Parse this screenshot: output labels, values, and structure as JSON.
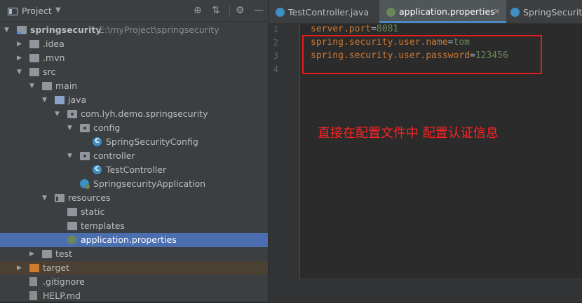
{
  "project_pane": {
    "title": "Project",
    "tools": [
      "⊕",
      "⇅",
      "⚙",
      "—"
    ]
  },
  "tree": [
    {
      "label": "springsecurity",
      "hint": "E:\\myProject\\springsecurity",
      "icon": "module-folder-icon",
      "depth": 0,
      "arrow": "down",
      "bold": true
    },
    {
      "label": ".idea",
      "icon": "folder-icon",
      "depth": 1,
      "arrow": "right"
    },
    {
      "label": ".mvn",
      "icon": "folder-icon",
      "depth": 1,
      "arrow": "right"
    },
    {
      "label": "src",
      "icon": "folder-icon",
      "depth": 1,
      "arrow": "down"
    },
    {
      "label": "main",
      "icon": "folder-icon",
      "depth": 2,
      "arrow": "down"
    },
    {
      "label": "java",
      "icon": "source-folder-icon",
      "depth": 3,
      "arrow": "down"
    },
    {
      "label": "com.lyh.demo.springsecurity",
      "icon": "package-icon",
      "depth": 4,
      "arrow": "down"
    },
    {
      "label": "config",
      "icon": "package-icon",
      "depth": 5,
      "arrow": "down"
    },
    {
      "label": "SpringSecurityConfig",
      "icon": "java-class-icon",
      "depth": 6,
      "arrow": ""
    },
    {
      "label": "controller",
      "icon": "package-icon",
      "depth": 5,
      "arrow": "down"
    },
    {
      "label": "TestController",
      "icon": "java-class-icon",
      "depth": 6,
      "arrow": ""
    },
    {
      "label": "SpringsecurityApplication",
      "icon": "spring-boot-app-icon",
      "depth": 5,
      "arrow": ""
    },
    {
      "label": "resources",
      "icon": "resources-folder-icon",
      "depth": 3,
      "arrow": "down"
    },
    {
      "label": "static",
      "icon": "folder-icon",
      "depth": 4,
      "arrow": ""
    },
    {
      "label": "templates",
      "icon": "folder-icon",
      "depth": 4,
      "arrow": ""
    },
    {
      "label": "application.properties",
      "icon": "spring-properties-icon",
      "depth": 4,
      "arrow": "",
      "selected": true
    },
    {
      "label": "test",
      "icon": "folder-icon",
      "depth": 2,
      "arrow": "right"
    },
    {
      "label": "target",
      "icon": "excluded-folder-icon",
      "depth": 1,
      "arrow": "right",
      "excluded": true
    },
    {
      "label": ".gitignore",
      "icon": "gitignore-file-icon",
      "depth": 1,
      "arrow": ""
    },
    {
      "label": "HELP.md",
      "icon": "markdown-file-icon",
      "depth": 1,
      "arrow": ""
    }
  ],
  "tabs": [
    {
      "label": "TestController.java",
      "icon": "java-class-icon",
      "active": false
    },
    {
      "label": "application.properties",
      "icon": "spring-properties-icon",
      "active": true
    },
    {
      "label": "SpringSecurity",
      "icon": "java-class-icon",
      "active": false
    }
  ],
  "editor": {
    "line_numbers": [
      "1",
      "2",
      "3",
      "4"
    ],
    "lines": [
      {
        "key": "server.port",
        "sep": "=",
        "value": "8081"
      },
      {
        "key": "spring.security.user.name",
        "sep": "=",
        "value": "tom"
      },
      {
        "key": "spring.security.user.password",
        "sep": "=",
        "value": "123456"
      },
      {
        "key": "",
        "sep": "",
        "value": ""
      }
    ],
    "annotation": "直接在配置文件中 配置认证信息"
  },
  "colors": {
    "key": "#cc7832",
    "value": "#6a8759",
    "annotation": "#ff2222",
    "selection": "#4b6eaf"
  }
}
